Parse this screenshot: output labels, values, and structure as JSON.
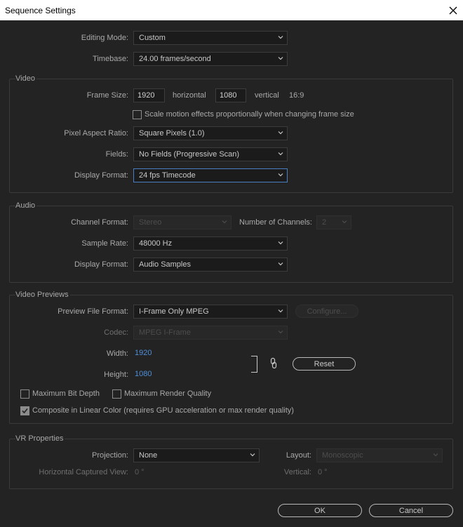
{
  "window": {
    "title": "Sequence Settings",
    "close_icon": "close-icon"
  },
  "general": {
    "editing_mode_label": "Editing Mode:",
    "editing_mode_value": "Custom",
    "timebase_label": "Timebase:",
    "timebase_value": "24.00  frames/second"
  },
  "video": {
    "section_title": "Video",
    "frame_size_label": "Frame Size:",
    "frame_width": "1920",
    "horizontal_label": "horizontal",
    "frame_height": "1080",
    "vertical_label": "vertical",
    "aspect_ratio": "16:9",
    "scale_motion_label": "Scale motion effects proportionally when changing frame size",
    "scale_motion_checked": false,
    "pixel_aspect_label": "Pixel Aspect Ratio:",
    "pixel_aspect_value": "Square Pixels (1.0)",
    "fields_label": "Fields:",
    "fields_value": "No Fields (Progressive Scan)",
    "display_format_label": "Display Format:",
    "display_format_value": "24 fps Timecode"
  },
  "audio": {
    "section_title": "Audio",
    "channel_format_label": "Channel Format:",
    "channel_format_value": "Stereo",
    "num_channels_label": "Number of Channels:",
    "num_channels_value": "2",
    "sample_rate_label": "Sample Rate:",
    "sample_rate_value": "48000 Hz",
    "display_format_label": "Display Format:",
    "display_format_value": "Audio Samples"
  },
  "video_previews": {
    "section_title": "Video Previews",
    "preview_format_label": "Preview File Format:",
    "preview_format_value": "I-Frame Only MPEG",
    "configure_label": "Configure...",
    "codec_label": "Codec:",
    "codec_value": "MPEG I-Frame",
    "width_label": "Width:",
    "width_value": "1920",
    "height_label": "Height:",
    "height_value": "1080",
    "reset_label": "Reset",
    "max_bit_depth_label": "Maximum Bit Depth",
    "max_bit_depth_checked": false,
    "max_render_quality_label": "Maximum Render Quality",
    "max_render_quality_checked": false,
    "linear_color_label": "Composite in Linear Color (requires GPU acceleration or max render quality)",
    "linear_color_checked": true
  },
  "vr": {
    "section_title": "VR Properties",
    "projection_label": "Projection:",
    "projection_value": "None",
    "layout_label": "Layout:",
    "layout_value": "Monoscopic",
    "horizontal_view_label": "Horizontal Captured View:",
    "horizontal_view_value": "0 °",
    "vertical_label": "Vertical:",
    "vertical_value": "0 °"
  },
  "footer": {
    "ok_label": "OK",
    "cancel_label": "Cancel"
  },
  "colors": {
    "background": "#232323",
    "accent_blue": "#4e8fd8",
    "focus_border": "#4a7fc4"
  }
}
